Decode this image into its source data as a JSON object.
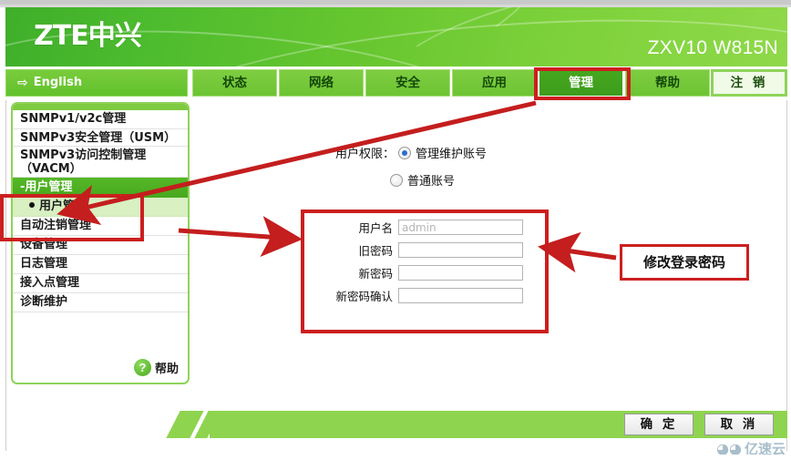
{
  "header": {
    "logo": "ZTE中兴",
    "model": "ZXV10 W815N"
  },
  "nav": {
    "english_label": "English",
    "english_icon": "right-arrow-icon",
    "tabs": [
      {
        "label": "状态",
        "active": false
      },
      {
        "label": "网络",
        "active": false
      },
      {
        "label": "安全",
        "active": false
      },
      {
        "label": "应用",
        "active": false
      },
      {
        "label": "管理",
        "active": true
      },
      {
        "label": "帮助",
        "active": false
      }
    ],
    "logout_label": "注 销"
  },
  "sidebar": {
    "items": [
      {
        "label": "SNMPv1/v2c管理",
        "type": "plain"
      },
      {
        "label": "SNMPv3安全管理（USM）",
        "type": "plain"
      },
      {
        "label": "SNMPv3访问控制管理（VACM）",
        "type": "plain"
      },
      {
        "label": "-用户管理",
        "type": "group-open"
      },
      {
        "label": "用户管理",
        "type": "sub"
      },
      {
        "label": "自动注销管理",
        "type": "plain"
      },
      {
        "label": "设备管理",
        "type": "plain"
      },
      {
        "label": "日志管理",
        "type": "plain"
      },
      {
        "label": "接入点管理",
        "type": "plain"
      },
      {
        "label": "诊断维护",
        "type": "plain"
      }
    ],
    "help_label": "帮助",
    "help_icon": "question-mark-icon"
  },
  "main": {
    "permission_label": "用户权限：",
    "permission_options": [
      {
        "label": "管理维护账号",
        "selected": true
      },
      {
        "label": "普通账号",
        "selected": false
      }
    ],
    "fields": [
      {
        "label": "用户名",
        "value": "admin",
        "placeholder": "",
        "readonly": true
      },
      {
        "label": "旧密码",
        "value": "",
        "placeholder": "",
        "readonly": false
      },
      {
        "label": "新密码",
        "value": "",
        "placeholder": "",
        "readonly": false
      },
      {
        "label": "新密码确认",
        "value": "",
        "placeholder": "",
        "readonly": false
      }
    ]
  },
  "annotation": {
    "callout_text": "修改登录密码",
    "highlight_color": "#cc1f1f"
  },
  "footer": {
    "ok_label": "确 定",
    "cancel_label": "取 消",
    "watermark": "亿速云"
  }
}
